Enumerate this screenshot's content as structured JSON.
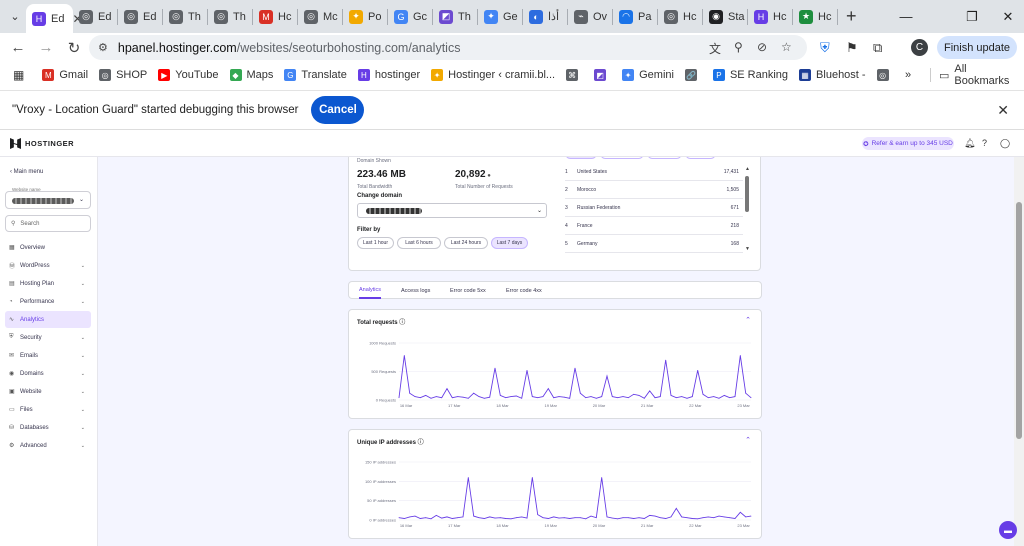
{
  "browser": {
    "tabs": [
      {
        "label": "Ed",
        "fav": "H",
        "color": "#673de6"
      },
      {
        "label": "Ed",
        "fav": "◎",
        "color": "#5f6368"
      },
      {
        "label": "Ed",
        "fav": "◎",
        "color": "#5f6368"
      },
      {
        "label": "Th",
        "fav": "◎",
        "color": "#5f6368"
      },
      {
        "label": "Th",
        "fav": "◎",
        "color": "#5f6368"
      },
      {
        "label": "Hc",
        "fav": "M",
        "color": "#d93025"
      },
      {
        "label": "Mc",
        "fav": "◎",
        "color": "#5f6368"
      },
      {
        "label": "Po",
        "fav": "✦",
        "color": "#f2a900"
      },
      {
        "label": "Gc",
        "fav": "G",
        "color": "#4285f4"
      },
      {
        "label": "Th",
        "fav": "◩",
        "color": "#6c4ad0"
      },
      {
        "label": "Ge",
        "fav": "✦",
        "color": "#4285f4"
      },
      {
        "label": "أذا",
        "fav": "◐",
        "color": "#2d6cdf"
      },
      {
        "label": "Ov",
        "fav": "⌁",
        "color": "#5f6368"
      },
      {
        "label": "Pa",
        "fav": "◠",
        "color": "#1a73e8"
      },
      {
        "label": "Hc",
        "fav": "◎",
        "color": "#5f6368"
      },
      {
        "label": "Sta",
        "fav": "◉",
        "color": "#202124"
      },
      {
        "label": "Hc",
        "fav": "H",
        "color": "#673de6"
      },
      {
        "label": "Hc",
        "fav": "★",
        "color": "#1e8e3e"
      }
    ],
    "url_host": "hpanel.hostinger.com",
    "url_path": "/websites/seoturbohosting.com/analytics",
    "finish_update": "Finish update",
    "profile_initial": "C",
    "bookmarks": [
      {
        "label": "Gmail",
        "icon": "M",
        "color": "#d93025"
      },
      {
        "label": "SHOP",
        "icon": "◎",
        "color": "#5f6368"
      },
      {
        "label": "YouTube",
        "icon": "▶",
        "color": "#ff0000"
      },
      {
        "label": "Maps",
        "icon": "◆",
        "color": "#34a853"
      },
      {
        "label": "Translate",
        "icon": "G",
        "color": "#4285f4"
      },
      {
        "label": "hostinger",
        "icon": "H",
        "color": "#673de6"
      },
      {
        "label": "Hostinger ‹ cramii.bl...",
        "icon": "✦",
        "color": "#f2a900"
      },
      {
        "label": "",
        "icon": "⌘",
        "color": "#5f6368"
      },
      {
        "label": "",
        "icon": "◩",
        "color": "#6c4ad0"
      },
      {
        "label": "Gemini",
        "icon": "✦",
        "color": "#4285f4"
      },
      {
        "label": "",
        "icon": "🔗",
        "color": "#5f6368"
      },
      {
        "label": "SE Ranking",
        "icon": "P",
        "color": "#1a73e8"
      },
      {
        "label": "Bluehost -",
        "icon": "▦",
        "color": "#1c3d95"
      },
      {
        "label": "",
        "icon": "◎",
        "color": "#5f6368"
      }
    ],
    "all_bookmarks": "All Bookmarks",
    "infobar_message": "\"Vroxy - Location Guard\" started debugging this browser",
    "infobar_cancel": "Cancel"
  },
  "app": {
    "logo": "HOSTINGER",
    "refer": "Refer & earn up to 345 USD",
    "sidebar": {
      "main_menu": "Main menu",
      "website_name_label": "Website name",
      "search_placeholder": "Search",
      "items": [
        {
          "label": "Overview",
          "icon": "▦",
          "chevron": ""
        },
        {
          "label": "WordPress",
          "icon": "Ⓦ",
          "chevron": "⌄"
        },
        {
          "label": "Hosting Plan",
          "icon": "▤",
          "chevron": "⌄"
        },
        {
          "label": "Performance",
          "icon": "◔",
          "chevron": "⌄"
        },
        {
          "label": "Analytics",
          "icon": "∿",
          "chevron": ""
        },
        {
          "label": "Security",
          "icon": "⛨",
          "chevron": "⌄"
        },
        {
          "label": "Emails",
          "icon": "✉",
          "chevron": "⌄"
        },
        {
          "label": "Domains",
          "icon": "◉",
          "chevron": "⌄"
        },
        {
          "label": "Website",
          "icon": "▣",
          "chevron": "⌄"
        },
        {
          "label": "Files",
          "icon": "▭",
          "chevron": "⌄"
        },
        {
          "label": "Databases",
          "icon": "⛁",
          "chevron": "⌄"
        },
        {
          "label": "Advanced",
          "icon": "⚙",
          "chevron": "⌄"
        }
      ]
    },
    "summary": {
      "domain_shown_label": "Domain Shown",
      "bandwidth_value": "223.46 MB",
      "bandwidth_label": "Total Bandwidth",
      "requests_value": "20,892",
      "requests_label": "Total Number of Requests",
      "change_domain": "Change domain",
      "filter_by": "Filter by",
      "filters": [
        "Last 1 hour",
        "Last 6 hours",
        "Last 24 hours",
        "Last 7 days"
      ],
      "selected_filter": "Last 7 days",
      "country_tabs": [
        "Countries",
        "IP Addresses",
        "Requests",
        "Domains"
      ],
      "countries": [
        {
          "rank": "1",
          "name": "United States",
          "value": "17,431"
        },
        {
          "rank": "2",
          "name": "Morocco",
          "value": "1,505"
        },
        {
          "rank": "3",
          "name": "Russian Federation",
          "value": "671"
        },
        {
          "rank": "4",
          "name": "France",
          "value": "218"
        },
        {
          "rank": "5",
          "name": "Germany",
          "value": "168"
        }
      ]
    },
    "analytics_tabs": [
      "Analytics",
      "Access logs",
      "Error code 5xx",
      "Error code 4xx"
    ],
    "charts": [
      {
        "title": "Total requests",
        "ylabels": [
          "1000 Requests",
          "500 Requests",
          "0 Requests"
        ]
      },
      {
        "title": "Unique IP addresses",
        "ylabels": [
          "150 IP addresses",
          "100 IP addresses",
          "50 IP addresses",
          "0 IP addresses"
        ]
      }
    ]
  },
  "chart_data": [
    {
      "type": "line",
      "title": "Total requests",
      "ylabel": "Requests",
      "ylim": [
        0,
        1000
      ],
      "xticks": [
        "16 Mar",
        "17 Mar",
        "18 Mar",
        "19 Mar",
        "20 Mar",
        "21 Mar",
        "22 Mar",
        "23 Mar"
      ],
      "series": [
        {
          "values": [
            40,
            780,
            120,
            60,
            40,
            80,
            30,
            60,
            40,
            200,
            40,
            60,
            50,
            30,
            120,
            60,
            30,
            50,
            560,
            80,
            40,
            60,
            70,
            30,
            520,
            60,
            40,
            60,
            200,
            40,
            60,
            50,
            30,
            560,
            120,
            40,
            60,
            30,
            60,
            420,
            60,
            40,
            60,
            40,
            100,
            80,
            30,
            160,
            40,
            60,
            700,
            80,
            40,
            60,
            30,
            60,
            520,
            100,
            40,
            60,
            30,
            80,
            40,
            60,
            780,
            120,
            40
          ]
        }
      ]
    },
    {
      "type": "line",
      "title": "Unique IP addresses",
      "ylabel": "IP addresses",
      "ylim": [
        0,
        150
      ],
      "xticks": [
        "16 Mar",
        "17 Mar",
        "18 Mar",
        "19 Mar",
        "20 Mar",
        "21 Mar",
        "22 Mar",
        "23 Mar"
      ],
      "series": [
        {
          "values": [
            6,
            4,
            8,
            10,
            4,
            6,
            3,
            12,
            5,
            8,
            4,
            6,
            8,
            110,
            10,
            6,
            4,
            8,
            5,
            6,
            4,
            3,
            6,
            8,
            5,
            110,
            14,
            6,
            4,
            8,
            5,
            6,
            4,
            6,
            6,
            3,
            10,
            6,
            110,
            8,
            5,
            3,
            6,
            6,
            4,
            6,
            4,
            12,
            10,
            6,
            4,
            8,
            30,
            8,
            6,
            4,
            3,
            6,
            8,
            6,
            10,
            8,
            6,
            4,
            20,
            8,
            10
          ]
        }
      ]
    }
  ]
}
